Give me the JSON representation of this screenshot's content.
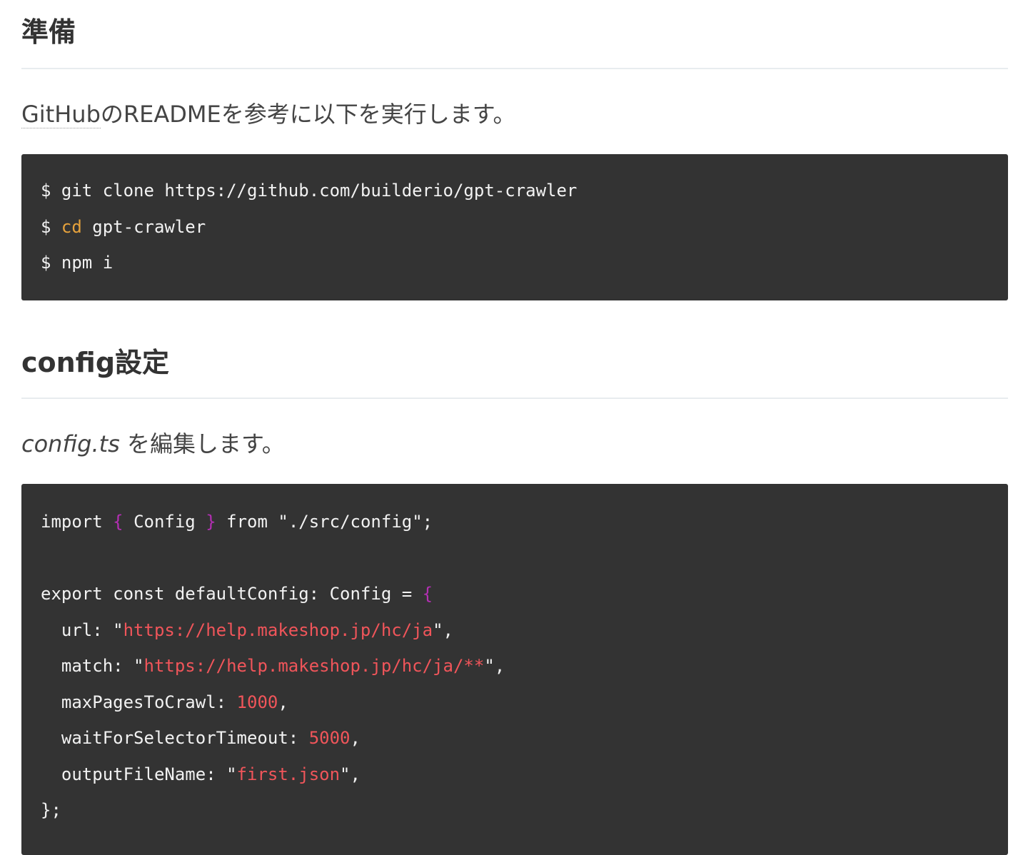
{
  "sections": [
    {
      "heading": "準備",
      "para": {
        "abbr": "GitHub",
        "text": "のREADMEを参考に以下を実行します。"
      },
      "code": {
        "line1": {
          "prompt": "$",
          "cmd": "git clone https://github.com/builderio/gpt-crawler"
        },
        "line2": {
          "prompt": "$",
          "builtin": "cd",
          "rest": "gpt-crawler"
        },
        "line3": {
          "prompt": "$",
          "cmd": "npm i"
        }
      }
    },
    {
      "heading": "config設定",
      "para": {
        "file": "config.ts",
        "text": " を編集します。"
      },
      "code": {
        "import": {
          "kw": "import",
          "open": "{",
          "name": "Config",
          "close": "}",
          "from": "from",
          "path": "\"./src/config\";"
        },
        "export": {
          "text": "export const defaultConfig: Config = ",
          "open": "{"
        },
        "url": {
          "key": "  url: \"",
          "value": "https://help.makeshop.jp/hc/ja",
          "end": "\","
        },
        "match": {
          "key": "  match: \"",
          "value": "https://help.makeshop.jp/hc/ja/**",
          "end": "\","
        },
        "maxPages": {
          "key": "  maxPagesToCrawl: ",
          "value": "1000",
          "end": ","
        },
        "waitFor": {
          "key": "  waitForSelectorTimeout: ",
          "value": "5000",
          "end": ","
        },
        "output": {
          "key": "  outputFileName: \"",
          "value": "first.json",
          "end": "\","
        },
        "close": "};"
      }
    }
  ],
  "colors": {
    "code_bg": "#333333",
    "builtin": "#e6a23c",
    "brace": "#b42fb4",
    "string": "#f0555a"
  }
}
